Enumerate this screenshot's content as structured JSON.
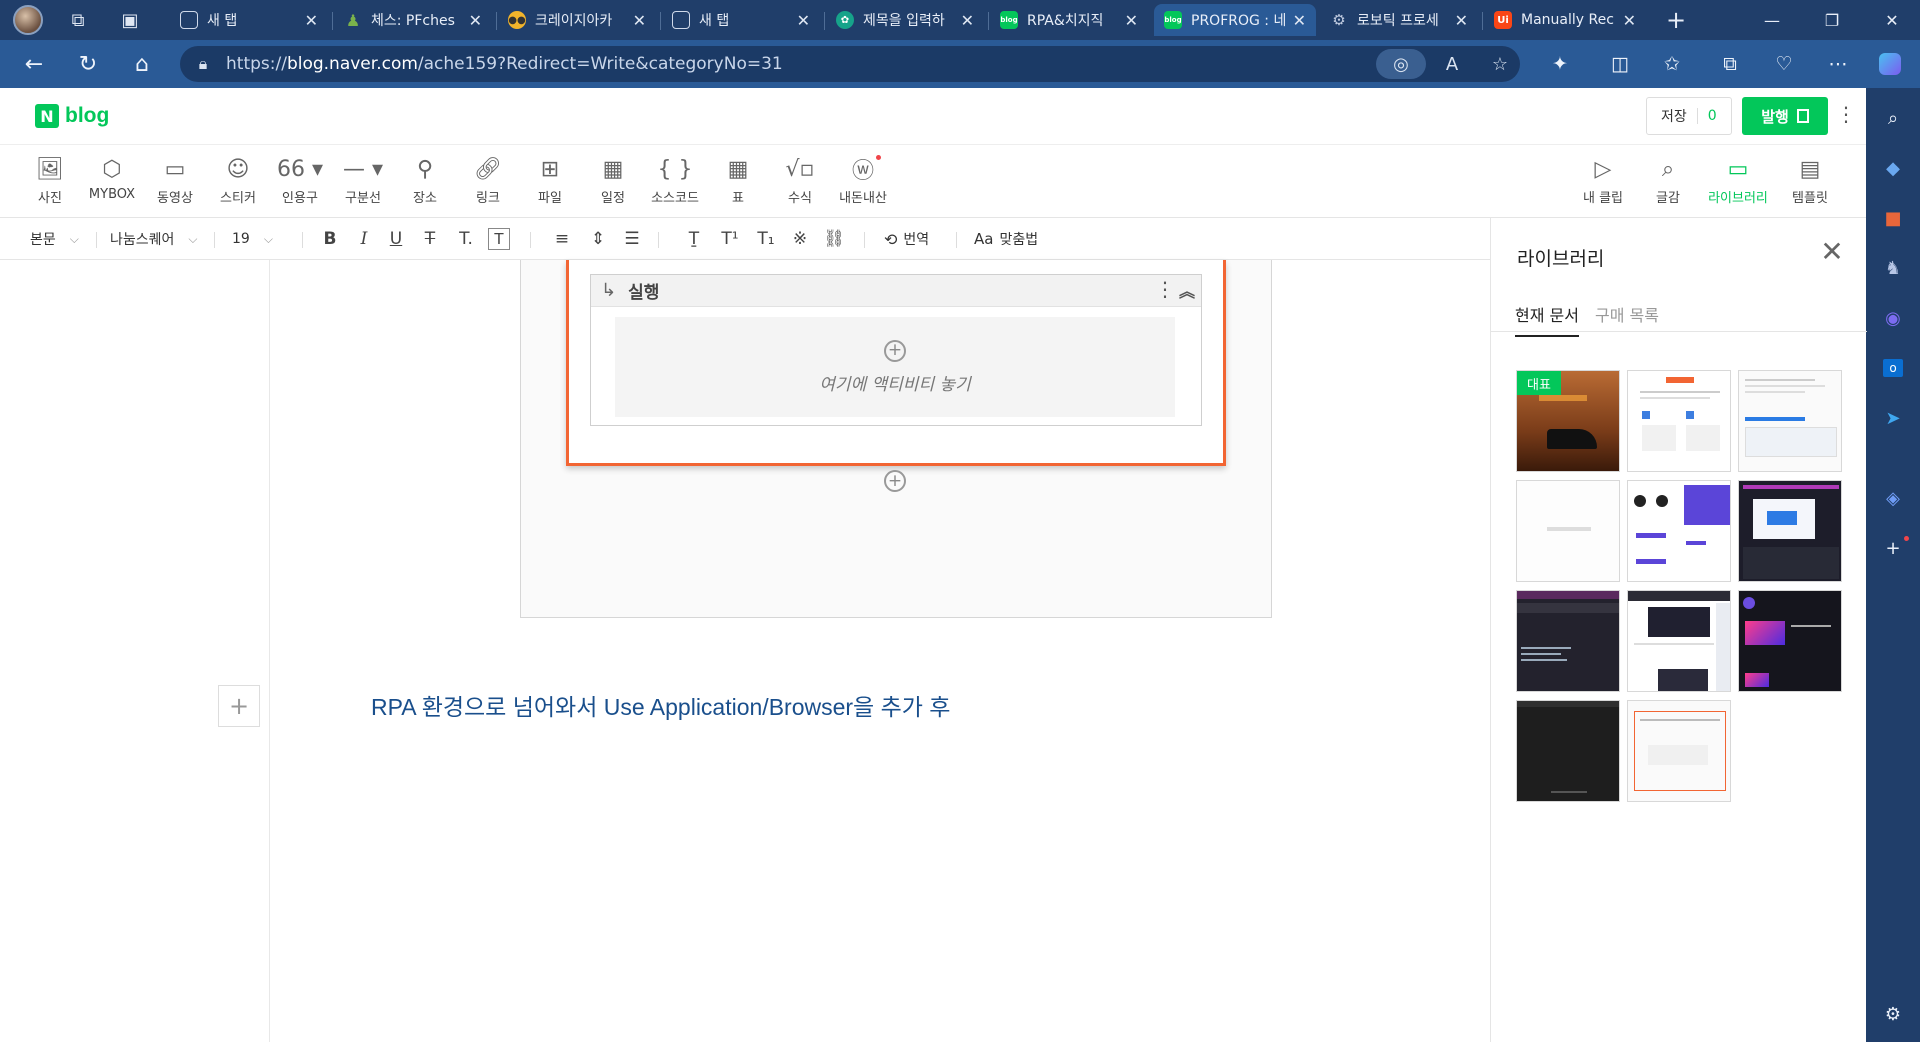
{
  "browser": {
    "tabs": [
      {
        "title": "새 탭",
        "favicon": "new-tab-icon",
        "color": "#5b7aa8"
      },
      {
        "title": "체스: PFches",
        "favicon": "chess-pawn-icon",
        "color": "#7ab24b"
      },
      {
        "title": "크레이지아카",
        "favicon": "glasses-icon",
        "color": "#f2b42b"
      },
      {
        "title": "새 탭",
        "favicon": "new-tab-icon",
        "color": "#5b7aa8"
      },
      {
        "title": "제목을 입력하",
        "favicon": "chatgpt-icon",
        "color": "#16a38a"
      },
      {
        "title": "RPA&치지직",
        "favicon": "naver-blog-icon",
        "color": "#03c75a"
      },
      {
        "title": "PROFROG : 네",
        "favicon": "naver-blog-icon",
        "color": "#03c75a"
      },
      {
        "title": "로보틱 프로세",
        "favicon": "network-icon",
        "color": "#9aa8c2"
      },
      {
        "title": "Manually Rec",
        "favicon": "uipath-icon",
        "color": "#fa4616"
      }
    ],
    "url_prefix": "https://",
    "url_domain": "blog.naver.com",
    "url_path": "/ache159?Redirect=Write&categoryNo=31"
  },
  "blog": {
    "logo_n": "N",
    "logo_text": "blog",
    "save_label": "저장",
    "save_count": "0",
    "publish_label": "발행"
  },
  "insert_toolbar": [
    {
      "label": "사진",
      "icon": "photo-icon"
    },
    {
      "label": "MYBOX",
      "icon": "mybox-icon"
    },
    {
      "label": "동영상",
      "icon": "video-icon"
    },
    {
      "label": "스티커",
      "icon": "sticker-icon"
    },
    {
      "label": "인용구",
      "icon": "quote-icon"
    },
    {
      "label": "구분선",
      "icon": "divider-icon"
    },
    {
      "label": "장소",
      "icon": "place-icon"
    },
    {
      "label": "링크",
      "icon": "link-icon"
    },
    {
      "label": "파일",
      "icon": "file-icon"
    },
    {
      "label": "일정",
      "icon": "calendar-icon"
    },
    {
      "label": "소스코드",
      "icon": "code-icon"
    },
    {
      "label": "표",
      "icon": "table-icon"
    },
    {
      "label": "수식",
      "icon": "formula-icon"
    },
    {
      "label": "내돈내산",
      "icon": "mymoney-icon"
    }
  ],
  "right_tools": [
    {
      "label": "내 클립",
      "icon": "clip-icon"
    },
    {
      "label": "글감",
      "icon": "material-search-icon"
    },
    {
      "label": "라이브러리",
      "icon": "library-icon",
      "active": true
    },
    {
      "label": "템플릿",
      "icon": "template-icon"
    }
  ],
  "format_toolbar": {
    "paragraph_style": "본문",
    "font": "나눔스퀘어",
    "size": "19",
    "translate": "번역",
    "spellcheck": "맞춤법"
  },
  "editor": {
    "sequence_title": "실행",
    "drop_hint": "여기에 액티비티 놓기",
    "body_line": "RPA 환경으로 넘어와서 Use Application/Browser을 추가 후"
  },
  "library": {
    "title": "라이브러리",
    "tabs": [
      "현재 문서",
      "구매 목록"
    ],
    "representative_badge": "대표",
    "thumbnail_count": 11
  },
  "colors": {
    "naver_green": "#03c75a",
    "uipath_orange": "#f26533",
    "browser_dark": "#203e6a",
    "browser_mid": "#2a5a96",
    "body_text": "#1a4f8c"
  }
}
